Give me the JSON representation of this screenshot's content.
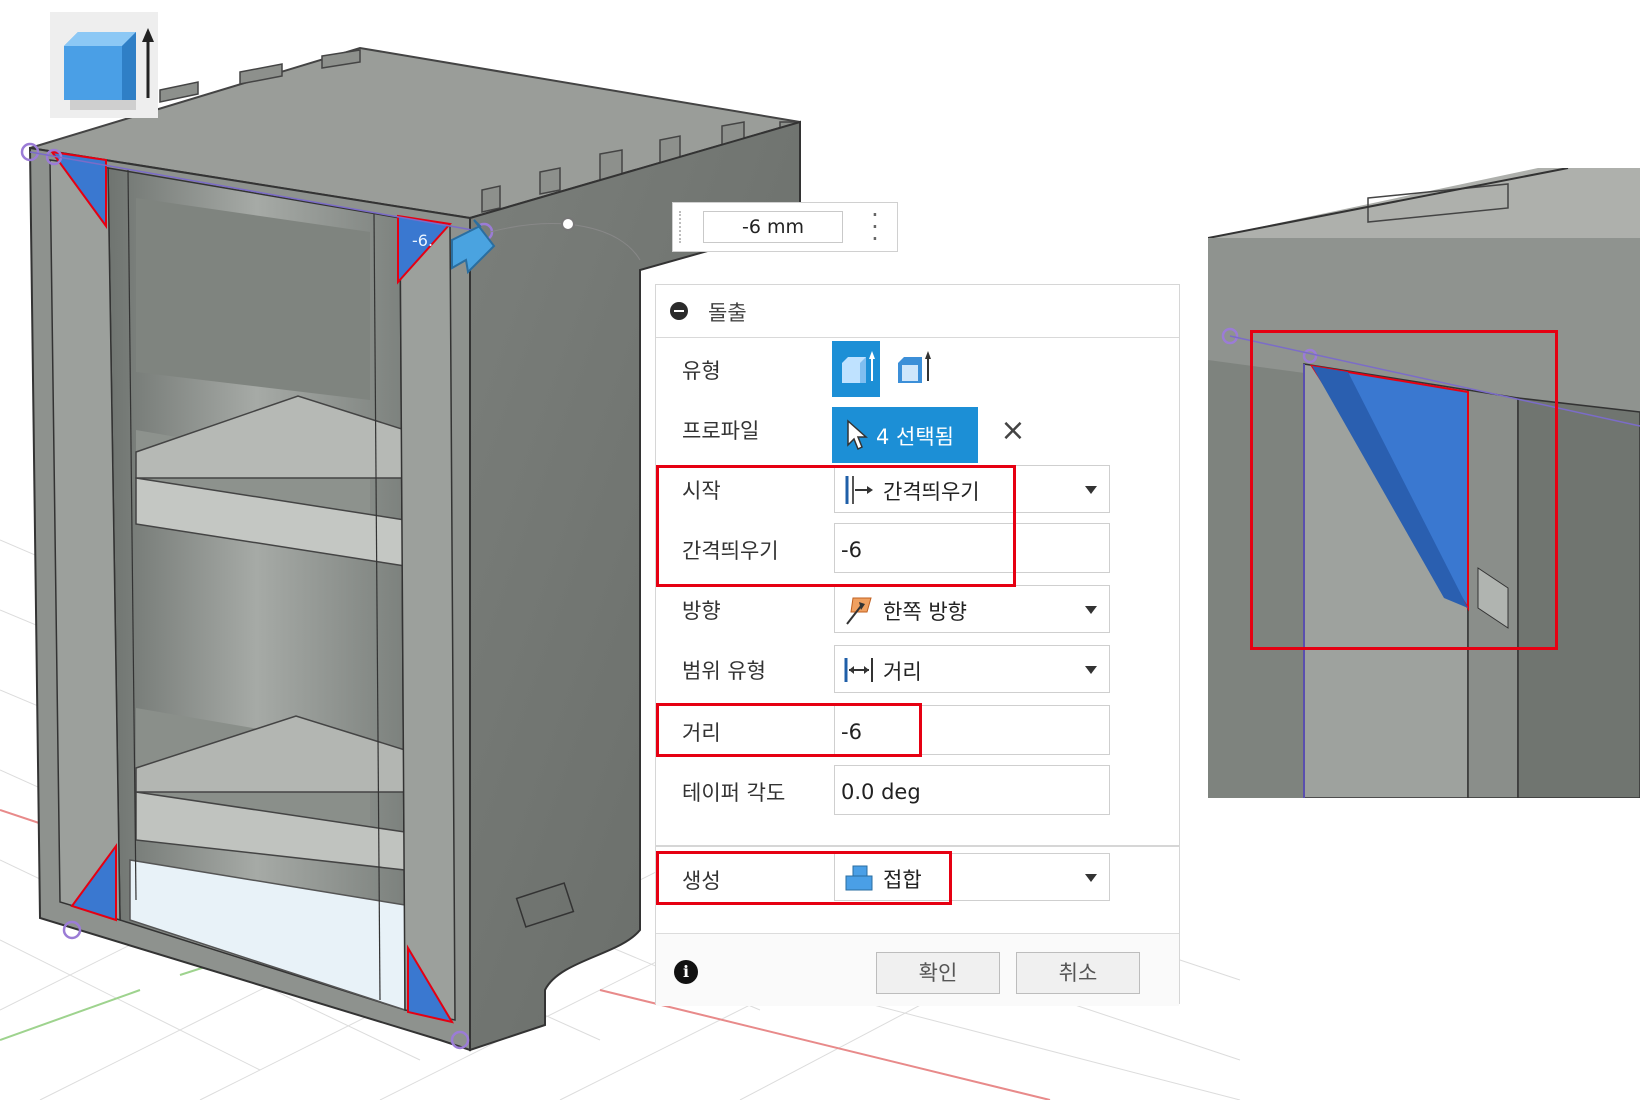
{
  "manipulator": {
    "distance_value": "-6 mm"
  },
  "dialog": {
    "title": "돌출",
    "type_label": "유형",
    "profile_label": "프로파일",
    "profile_selected": "4 선택됨",
    "start_label": "시작",
    "start_value": "간격띄우기",
    "offset_label": "간격띄우기",
    "offset_value": "-6",
    "direction_label": "방향",
    "direction_value": "한쪽 방향",
    "extent_label": "범위 유형",
    "extent_value": "거리",
    "distance_label": "거리",
    "distance_value": "-6",
    "taper_label": "테이퍼 각도",
    "taper_value": "0.0 deg",
    "operation_label": "생성",
    "operation_value": "접합",
    "ok_label": "확인",
    "cancel_label": "취소"
  },
  "colors": {
    "accent": "#1c8fd6",
    "highlight": "#e60012",
    "face_selected": "#3a78d0",
    "model_gray": "#8f938f"
  }
}
